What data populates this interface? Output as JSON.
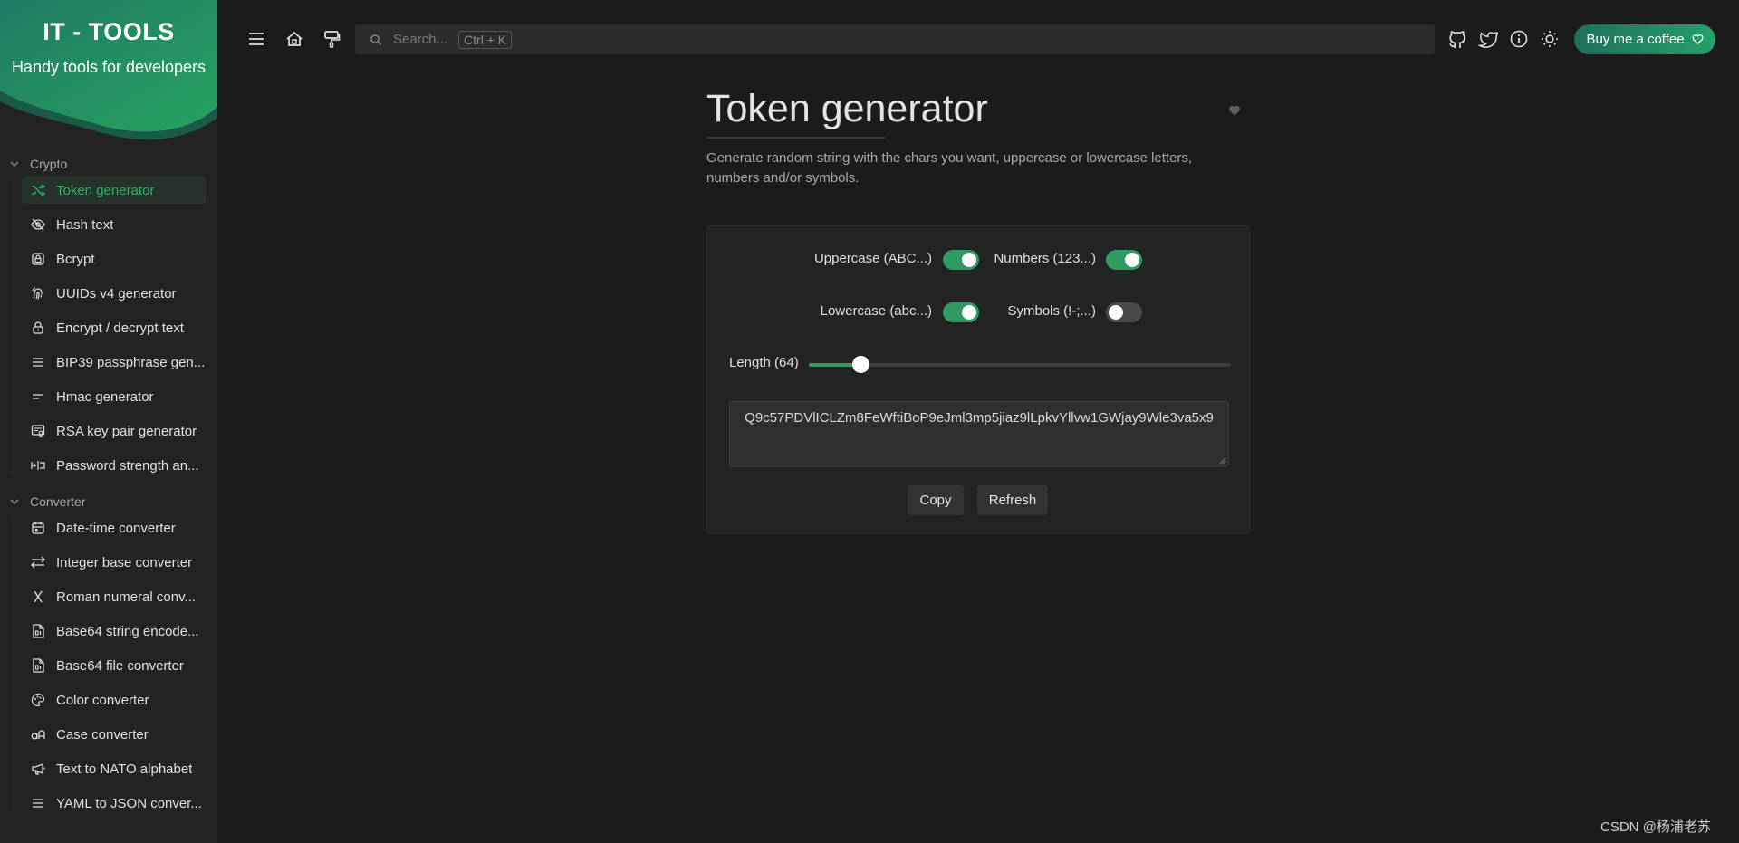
{
  "brand": {
    "title": "IT - TOOLS",
    "subtitle": "Handy tools for developers"
  },
  "sidebar": {
    "sections": [
      {
        "title": "Crypto",
        "items": [
          {
            "label": "Token generator",
            "icon": "shuffle-icon",
            "active": true
          },
          {
            "label": "Hash text",
            "icon": "eye-off-icon"
          },
          {
            "label": "Bcrypt",
            "icon": "lock-square-icon"
          },
          {
            "label": "UUIDs v4 generator",
            "icon": "fingerprint-icon"
          },
          {
            "label": "Encrypt / decrypt text",
            "icon": "lock-icon"
          },
          {
            "label": "BIP39 passphrase gen...",
            "icon": "lines-icon"
          },
          {
            "label": "Hmac generator",
            "icon": "short-lines-icon"
          },
          {
            "label": "RSA key pair generator",
            "icon": "certificate-icon"
          },
          {
            "label": "Password strength an...",
            "icon": "password-icon"
          }
        ]
      },
      {
        "title": "Converter",
        "items": [
          {
            "label": "Date-time converter",
            "icon": "calendar-icon"
          },
          {
            "label": "Integer base converter",
            "icon": "arrows-left-right-icon"
          },
          {
            "label": "Roman numeral conv...",
            "icon": "letter-x-icon"
          },
          {
            "label": "Base64 string encode...",
            "icon": "file-digit-icon"
          },
          {
            "label": "Base64 file converter",
            "icon": "file-digit-icon"
          },
          {
            "label": "Color converter",
            "icon": "palette-icon"
          },
          {
            "label": "Case converter",
            "icon": "letter-case-icon"
          },
          {
            "label": "Text to NATO alphabet",
            "icon": "speakerphone-icon"
          },
          {
            "label": "YAML to JSON conver...",
            "icon": "lines-icon"
          }
        ]
      }
    ]
  },
  "header": {
    "search_placeholder": "Search...",
    "search_shortcut": "Ctrl + K",
    "coffee_label": "Buy me a coffee"
  },
  "main": {
    "title": "Token generator",
    "description": "Generate random string with the chars you want, uppercase or lowercase letters, numbers and/or symbols.",
    "options": {
      "uppercase": {
        "label": "Uppercase (ABC...)",
        "on": true
      },
      "numbers": {
        "label": "Numbers (123...)",
        "on": true
      },
      "lowercase": {
        "label": "Lowercase (abc...)",
        "on": true
      },
      "symbols": {
        "label": "Symbols (!-;...)",
        "on": false
      }
    },
    "length": {
      "label": "Length (64)",
      "value": 64,
      "min": 1,
      "max": 512
    },
    "token": "Q9c57PDVlICLZm8FeWftiBoP9eJml3mp5jiaz9lLpkvYllvw1GWjay9Wle3va5x9",
    "copy_label": "Copy",
    "refresh_label": "Refresh"
  },
  "watermark": "CSDN @杨浦老苏",
  "colors": {
    "accent": "#2f9a63",
    "active_text": "#28b463",
    "background": "#1c1c1c"
  }
}
